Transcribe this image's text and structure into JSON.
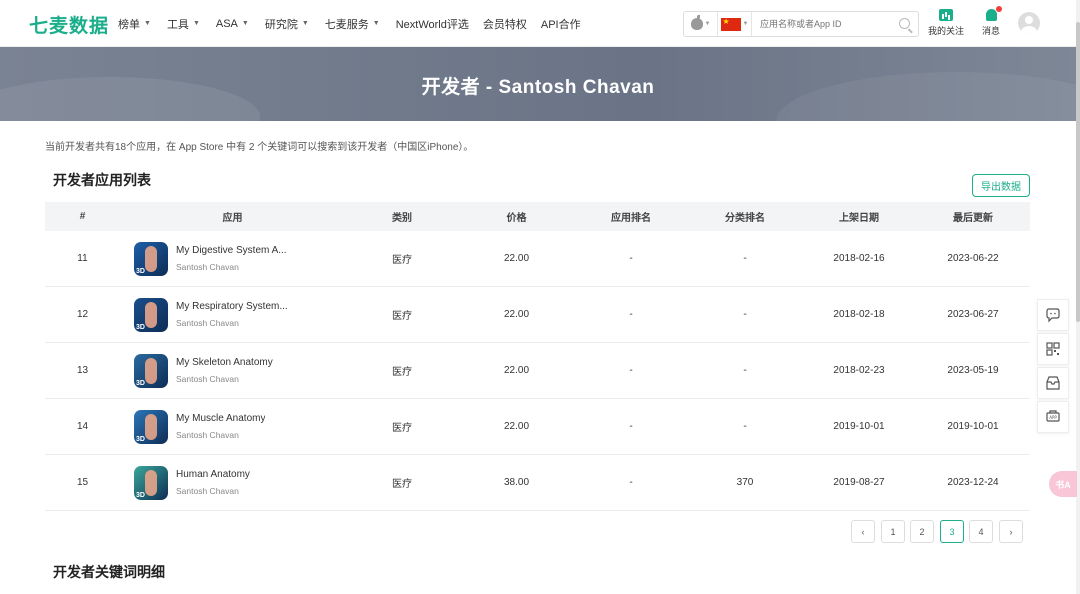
{
  "header": {
    "logo": "七麦数据",
    "nav": [
      {
        "label": "榜单",
        "dropdown": true
      },
      {
        "label": "工具",
        "dropdown": true
      },
      {
        "label": "ASA",
        "dropdown": true
      },
      {
        "label": "研究院",
        "dropdown": true
      },
      {
        "label": "七麦服务",
        "dropdown": true
      },
      {
        "label": "NextWorld评选",
        "dropdown": false
      },
      {
        "label": "会员特权",
        "dropdown": false
      },
      {
        "label": "API合作",
        "dropdown": false
      }
    ],
    "search": {
      "placeholder": "应用名称或者App ID"
    },
    "follow_label": "我的关注",
    "message_label": "消息"
  },
  "banner": {
    "title": "开发者 - Santosh Chavan"
  },
  "summary": "当前开发者共有18个应用，在 App Store 中有 2 个关键词可以搜索到该开发者（中国区iPhone）。",
  "apps_section": {
    "title": "开发者应用列表",
    "export_label": "导出数据",
    "columns": [
      "#",
      "应用",
      "类别",
      "价格",
      "应用排名",
      "分类排名",
      "上架日期",
      "最后更新"
    ],
    "rows": [
      {
        "rank": "11",
        "name": "My Digestive System A...",
        "developer": "Santosh Chavan",
        "category": "医疗",
        "price": "22.00",
        "app_rank": "-",
        "cat_rank": "-",
        "release": "2018-02-16",
        "updated": "2023-06-22",
        "icon": "digestive-system-icon",
        "color": "#1d5fa8"
      },
      {
        "rank": "12",
        "name": "My Respiratory System...",
        "developer": "Santosh Chavan",
        "category": "医疗",
        "price": "22.00",
        "app_rank": "-",
        "cat_rank": "-",
        "release": "2018-02-18",
        "updated": "2023-06-27",
        "icon": "respiratory-system-icon",
        "color": "#1b4e8c"
      },
      {
        "rank": "13",
        "name": "My Skeleton Anatomy",
        "developer": "Santosh Chavan",
        "category": "医疗",
        "price": "22.00",
        "app_rank": "-",
        "cat_rank": "-",
        "release": "2018-02-23",
        "updated": "2023-05-19",
        "icon": "skeleton-icon",
        "color": "#2a6a9e"
      },
      {
        "rank": "14",
        "name": "My Muscle Anatomy",
        "developer": "Santosh Chavan",
        "category": "医疗",
        "price": "22.00",
        "app_rank": "-",
        "cat_rank": "-",
        "release": "2019-10-01",
        "updated": "2019-10-01",
        "icon": "muscle-icon",
        "color": "#2b76b8"
      },
      {
        "rank": "15",
        "name": "Human Anatomy",
        "developer": "Santosh Chavan",
        "category": "医疗",
        "price": "38.00",
        "app_rank": "-",
        "cat_rank": "370",
        "release": "2019-08-27",
        "updated": "2023-12-24",
        "icon": "human-anatomy-icon",
        "color": "#3aa89a"
      }
    ]
  },
  "pagination": {
    "pages": [
      "1",
      "2",
      "3",
      "4"
    ],
    "current": "3",
    "prev": "‹",
    "next": "›"
  },
  "keywords_section": {
    "title": "开发者关键词明细"
  },
  "float_badge": "书A",
  "colors": {
    "brand": "#1aae8a",
    "banner": "#737d8e"
  }
}
